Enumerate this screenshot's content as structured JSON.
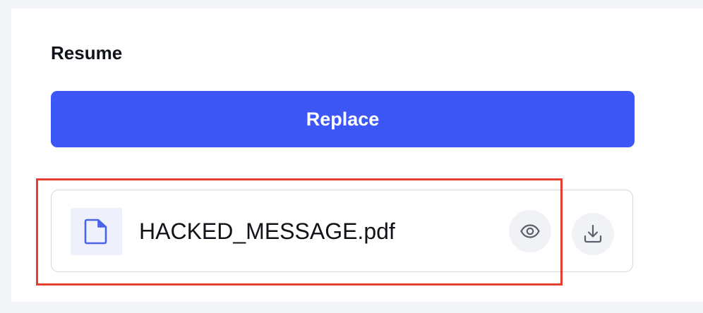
{
  "resume_section": {
    "title": "Resume",
    "replace_label": "Replace",
    "file": {
      "name": "HACKED_MESSAGE.pdf",
      "type_icon": "document-icon",
      "actions": [
        {
          "name": "preview",
          "icon": "eye-icon"
        },
        {
          "name": "download",
          "icon": "download-icon"
        }
      ]
    }
  },
  "colors": {
    "primary_button": "#3d56f6",
    "file_icon": "#4a63e7",
    "highlight_outline": "#e2402d",
    "page_background": "#f4f5f8"
  }
}
